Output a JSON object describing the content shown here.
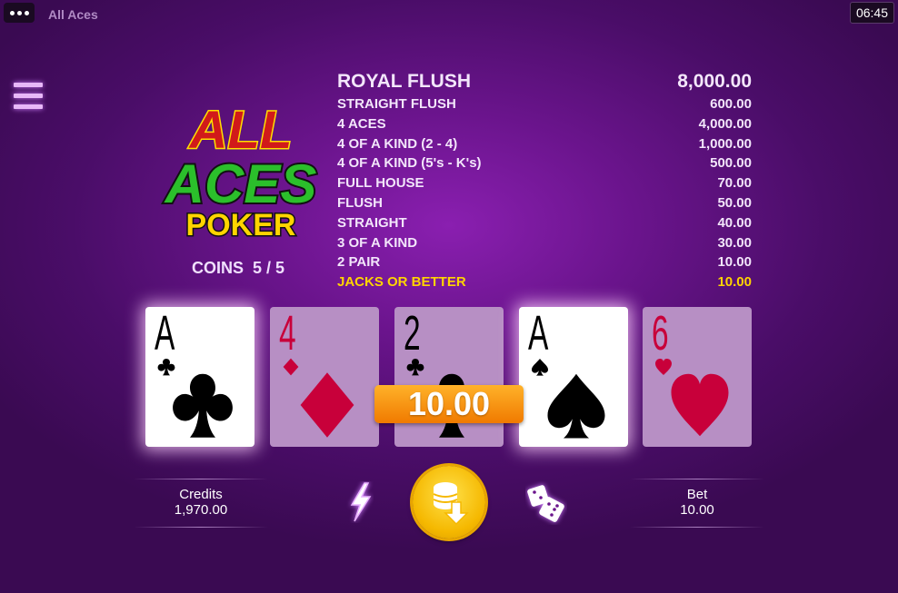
{
  "topbar": {
    "app_title": "All Aces",
    "clock": "06:45"
  },
  "logo": {
    "line1": "ALL",
    "line2": "ACES",
    "line3": "POKER"
  },
  "coins": {
    "label": "COINS",
    "value": "5 / 5"
  },
  "paytable": [
    {
      "hand": "ROYAL FLUSH",
      "payout": "8,000.00"
    },
    {
      "hand": "STRAIGHT FLUSH",
      "payout": "600.00"
    },
    {
      "hand": "4 ACES",
      "payout": "4,000.00"
    },
    {
      "hand": "4 OF A KIND (2 - 4)",
      "payout": "1,000.00"
    },
    {
      "hand": "4 OF A KIND (5's - K's)",
      "payout": "500.00"
    },
    {
      "hand": "FULL HOUSE",
      "payout": "70.00"
    },
    {
      "hand": "FLUSH",
      "payout": "50.00"
    },
    {
      "hand": "STRAIGHT",
      "payout": "40.00"
    },
    {
      "hand": "3 OF A KIND",
      "payout": "30.00"
    },
    {
      "hand": "2 PAIR",
      "payout": "10.00"
    },
    {
      "hand": "JACKS OR BETTER",
      "payout": "10.00"
    }
  ],
  "cards": [
    {
      "rank": "A",
      "suit": "clubs",
      "held": true
    },
    {
      "rank": "4",
      "suit": "diamonds",
      "held": false
    },
    {
      "rank": "2",
      "suit": "clubs",
      "held": false
    },
    {
      "rank": "A",
      "suit": "spades",
      "held": true
    },
    {
      "rank": "6",
      "suit": "hearts",
      "held": false
    }
  ],
  "win_amount": "10.00",
  "credits": {
    "label": "Credits",
    "value": "1,970.00"
  },
  "bet": {
    "label": "Bet",
    "value": "10.00"
  },
  "icons": {
    "menu": "hamburger-icon",
    "autoplay": "lightning-icon",
    "deal": "coins-deal-icon",
    "gamble": "dice-icon"
  },
  "colors": {
    "highlight": "#ffd400",
    "win_badge": "#f59000",
    "deal_button": "#f5b800"
  }
}
